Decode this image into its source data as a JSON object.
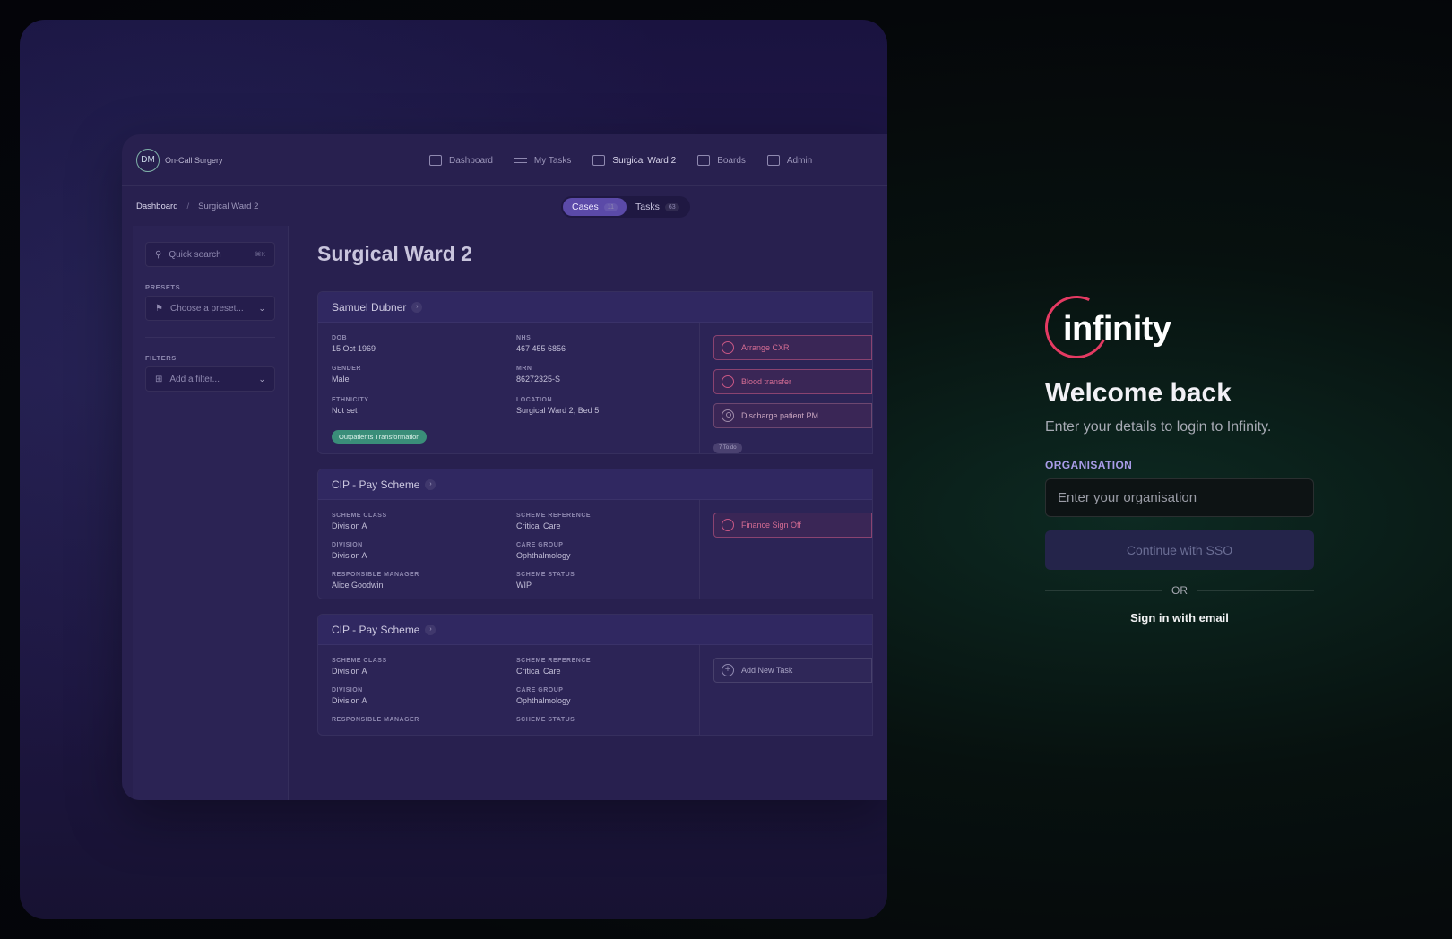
{
  "app": {
    "avatar_initials": "DM",
    "org_name": "On-Call Surgery",
    "nav": [
      {
        "label": "Dashboard",
        "icon": "layout-icon"
      },
      {
        "label": "My Tasks",
        "icon": "list-icon"
      },
      {
        "label": "Surgical Ward 2",
        "icon": "ward-icon"
      },
      {
        "label": "Boards",
        "icon": "boards-icon"
      },
      {
        "label": "Admin",
        "icon": "admin-icon"
      }
    ],
    "breadcrumb": {
      "root": "Dashboard",
      "separator": "/",
      "current": "Surgical Ward 2"
    },
    "switcher": {
      "cases_label": "Cases",
      "cases_count": "11",
      "tasks_label": "Tasks",
      "tasks_count": "63"
    },
    "sidebar": {
      "search_placeholder": "Quick search",
      "search_shortcut": "⌘K",
      "presets_label": "PRESETS",
      "preset_placeholder": "Choose a preset...",
      "filters_label": "FILTERS",
      "filter_placeholder": "Add a filter..."
    },
    "page_title": "Surgical Ward 2",
    "patient_case": {
      "name": "Samuel Dubner",
      "fields": [
        {
          "key": "DOB",
          "value": "15 Oct 1969"
        },
        {
          "key": "NHS",
          "value": "467 455 6856"
        },
        {
          "key": "GENDER",
          "value": "Male"
        },
        {
          "key": "MRN",
          "value": "86272325-S"
        },
        {
          "key": "ETHNICITY",
          "value": "Not set"
        },
        {
          "key": "LOCATION",
          "value": "Surgical Ward 2, Bed 5"
        }
      ],
      "tag": "Outpatients Transformation",
      "tasks": [
        "Arrange CXR",
        "Blood transfer",
        "Discharge patient PM"
      ],
      "todo_label": "7 To do"
    },
    "scheme_case_1": {
      "name": "CIP - Pay Scheme",
      "fields": [
        {
          "key": "SCHEME CLASS",
          "value": "Division A"
        },
        {
          "key": "SCHEME REFERENCE",
          "value": "Critical Care"
        },
        {
          "key": "DIVISION",
          "value": "Division A"
        },
        {
          "key": "CARE GROUP",
          "value": "Ophthalmology"
        },
        {
          "key": "RESPONSIBLE MANAGER",
          "value": "Alice Goodwin"
        },
        {
          "key": "SCHEME STATUS",
          "value": "WIP"
        }
      ],
      "tasks": [
        "Finance Sign Off"
      ]
    },
    "scheme_case_2": {
      "name": "CIP - Pay Scheme",
      "fields": [
        {
          "key": "SCHEME CLASS",
          "value": "Division A"
        },
        {
          "key": "SCHEME REFERENCE",
          "value": "Critical Care"
        },
        {
          "key": "DIVISION",
          "value": "Division A"
        },
        {
          "key": "CARE GROUP",
          "value": "Ophthalmology"
        },
        {
          "key": "RESPONSIBLE MANAGER",
          "value": ""
        },
        {
          "key": "SCHEME STATUS",
          "value": ""
        }
      ],
      "add_task_label": "Add New Task"
    }
  },
  "login": {
    "logo_text": "infinity",
    "title": "Welcome back",
    "subtitle": "Enter your details to login to Infinity.",
    "org_label": "ORGANISATION",
    "org_placeholder": "Enter your organisation",
    "org_value": "",
    "sso_button": "Continue with SSO",
    "or_text": "OR",
    "email_link": "Sign in with email"
  },
  "colors": {
    "accent_red": "#e43a62",
    "label_purple": "#a99ce8",
    "tag_green": "#3a8e79",
    "task_pink": "#d36c93",
    "active_tab": "#5b4aa8"
  }
}
